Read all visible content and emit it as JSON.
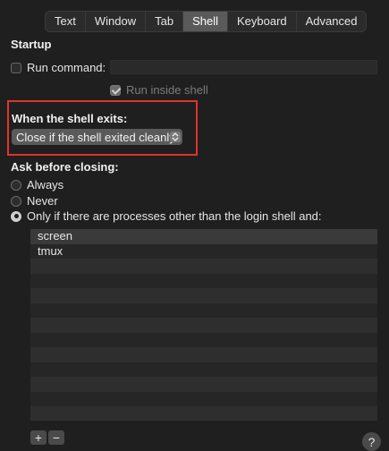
{
  "tabs": [
    {
      "label": "Text"
    },
    {
      "label": "Window"
    },
    {
      "label": "Tab"
    },
    {
      "label": "Shell",
      "active": true
    },
    {
      "label": "Keyboard"
    },
    {
      "label": "Advanced"
    }
  ],
  "startup": {
    "title": "Startup",
    "run_command_label": "Run command:",
    "run_command_value": "",
    "run_inside_shell_label": "Run inside shell"
  },
  "shell_exit": {
    "title": "When the shell exits:",
    "selected_option": "Close if the shell exited cleanly"
  },
  "ask_before_closing": {
    "title": "Ask before closing:",
    "options": [
      {
        "label": "Always"
      },
      {
        "label": "Never"
      },
      {
        "label": "Only if there are processes other than the login shell and:"
      }
    ]
  },
  "process_list": {
    "items": [
      "screen",
      "tmux"
    ]
  },
  "buttons": {
    "add": "+",
    "remove": "−",
    "help": "?"
  },
  "colors": {
    "highlight_border": "#e0342c",
    "background": "#1f1f1f"
  }
}
